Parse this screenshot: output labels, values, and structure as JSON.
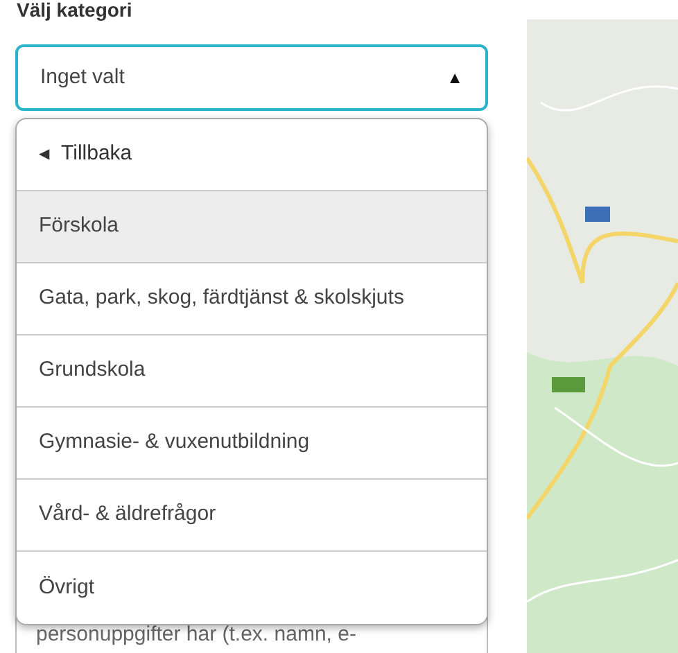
{
  "field_label": "Välj kategori",
  "select": {
    "value": "Inget valt",
    "expanded": true,
    "caret": "▲"
  },
  "menu": {
    "back": {
      "icon": "◀",
      "label": "Tillbaka"
    },
    "items": [
      {
        "label": "Förskola",
        "selected": true
      },
      {
        "label": "Gata, park, skog, färdtjänst & skolskjuts",
        "selected": false
      },
      {
        "label": "Grundskola",
        "selected": false
      },
      {
        "label": "Gymnasie- & vuxenutbildning",
        "selected": false
      },
      {
        "label": "Vård- & äldrefrågor",
        "selected": false
      },
      {
        "label": "Övrigt",
        "selected": false
      }
    ]
  },
  "background_text": "personuppgifter har (t.ex. namn, e-"
}
